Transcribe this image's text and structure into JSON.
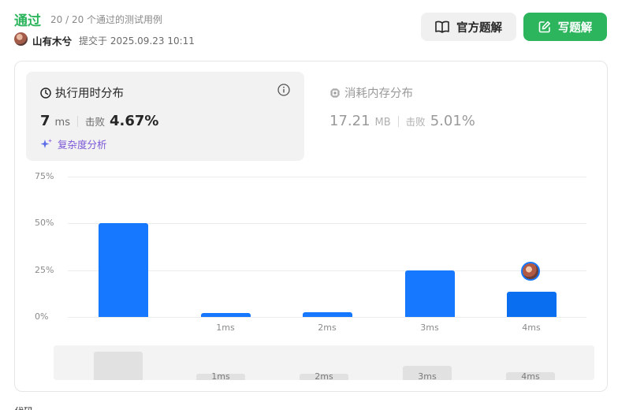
{
  "header": {
    "status": "通过",
    "tests_passed": "20 / 20 个通过的测试用例",
    "user_name": "山有木兮",
    "submitted_at": "提交于 2025.09.23 10:11",
    "official_solution_label": "官方题解",
    "write_solution_label": "写题解"
  },
  "runtime": {
    "title": "执行用时分布",
    "value": "7",
    "unit": "ms",
    "beats_label": "击败",
    "beats_pct": "4.67%",
    "complexity_label": "复杂度分析"
  },
  "memory": {
    "title": "消耗内存分布",
    "value": "17.21",
    "unit": "MB",
    "beats_label": "击败",
    "beats_pct": "5.01%"
  },
  "chart_data": {
    "type": "bar",
    "categories": [
      "",
      "1ms",
      "2ms",
      "3ms",
      "4ms"
    ],
    "values": [
      50,
      2,
      2.5,
      25,
      13.5
    ],
    "y_ticks": [
      "75%",
      "50%",
      "25%",
      "0%"
    ],
    "ylim": [
      0,
      75
    ],
    "highlight_category": "4ms",
    "overview_labels": [
      "1ms",
      "2ms",
      "3ms",
      "4ms"
    ],
    "bar_color": "#1677ff",
    "grid": true
  },
  "colors": {
    "accent_green": "#2db55d",
    "bar_blue": "#1677ff",
    "complexity_purple": "#7a56d6"
  },
  "icons": {
    "clock": "clock-icon",
    "info": "info-icon",
    "chip": "chip-icon",
    "sparkle": "sparkle-icon",
    "book": "book-icon",
    "edit": "edit-icon"
  },
  "footer_partial": "代码"
}
